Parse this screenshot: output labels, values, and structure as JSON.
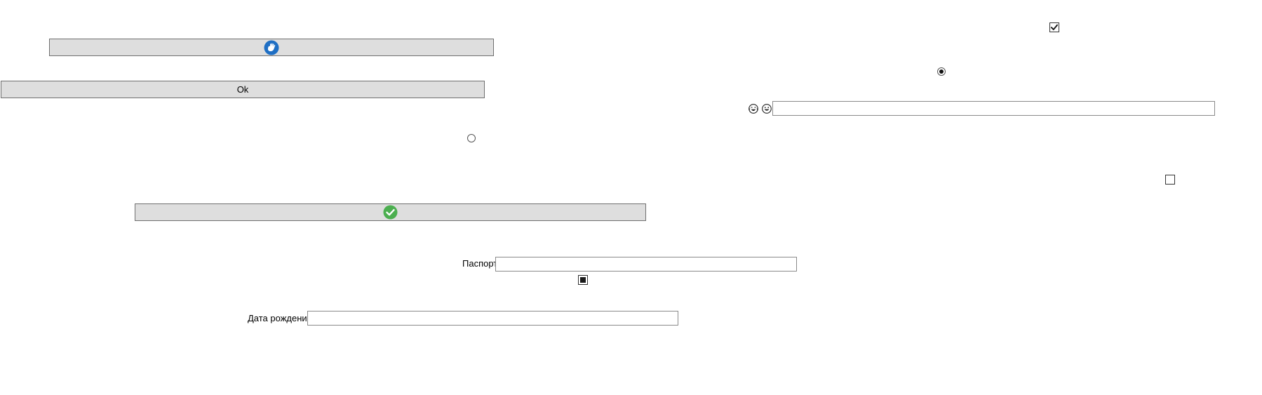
{
  "buttons": {
    "top_icon_label": "",
    "ok_label": "Ok",
    "check_icon_label": ""
  },
  "icons": {
    "top_button_icon": "blue-hand-icon",
    "check_button_icon": "green-check-icon",
    "emoji_left": "grinning-tears-face-icon",
    "emoji_right": "grinning-face-icon"
  },
  "labels": {
    "passport": "Паспорт",
    "birth_date": "Дата рождения"
  },
  "fields": {
    "passport_value": "",
    "birth_date_value": "",
    "right_value": ""
  },
  "controls": {
    "checkbox_top_checked": true,
    "checkbox_right_checked": false,
    "checkbox_mid_state": "indeterminate",
    "radio_right_checked": true,
    "radio_left_checked": false
  },
  "colors": {
    "button_bg": "#dedede",
    "button_border": "#6f6f6f",
    "hand_icon_blue": "#1f6fc4",
    "check_icon_green": "#4caf50"
  }
}
